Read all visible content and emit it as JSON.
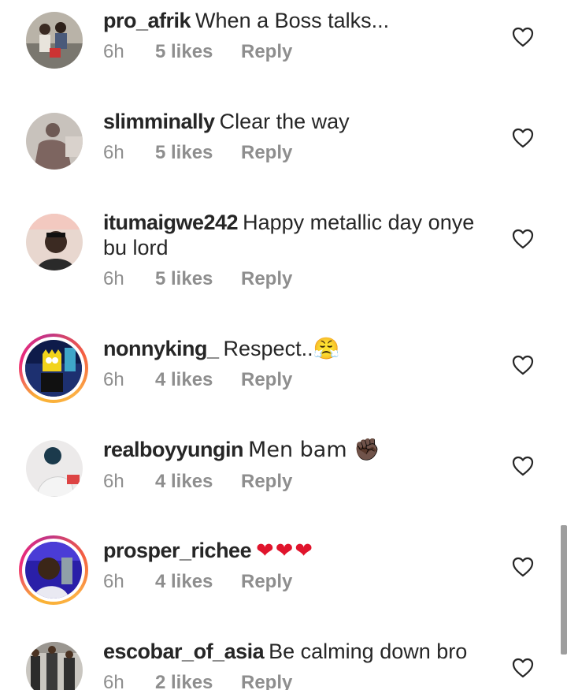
{
  "comments": [
    {
      "username": "pro_afrik",
      "text": "When a Boss talks...",
      "time": "6h",
      "likes": "5 likes",
      "reply": "Reply"
    },
    {
      "username": "slimminally",
      "text": "Clear the way",
      "time": "6h",
      "likes": "5 likes",
      "reply": "Reply"
    },
    {
      "username": "itumaigwe242",
      "text": "Happy metallic day onye bu lord",
      "time": "6h",
      "likes": "5 likes",
      "reply": "Reply"
    },
    {
      "username": "nonnyking_",
      "text": "Respect..😤",
      "time": "6h",
      "likes": "4 likes",
      "reply": "Reply"
    },
    {
      "username": "realboyyungin",
      "text": "Men bam ✊🏿",
      "time": "6h",
      "likes": "4 likes",
      "reply": "Reply"
    },
    {
      "username": "prosper_richee",
      "text": "❤❤❤",
      "time": "6h",
      "likes": "4 likes",
      "reply": "Reply"
    },
    {
      "username": "escobar_of_asia",
      "text": "Be calming down bro",
      "time": "6h",
      "likes": "2 likes",
      "reply": "Reply"
    }
  ],
  "icons": {
    "like": "heart-outline-icon"
  },
  "colors": {
    "username": "#262626",
    "meta": "#8e8e8e",
    "story_ring_start": "#f9b233",
    "story_ring_end": "#c13584",
    "heart_emoji": "#e0142c"
  }
}
